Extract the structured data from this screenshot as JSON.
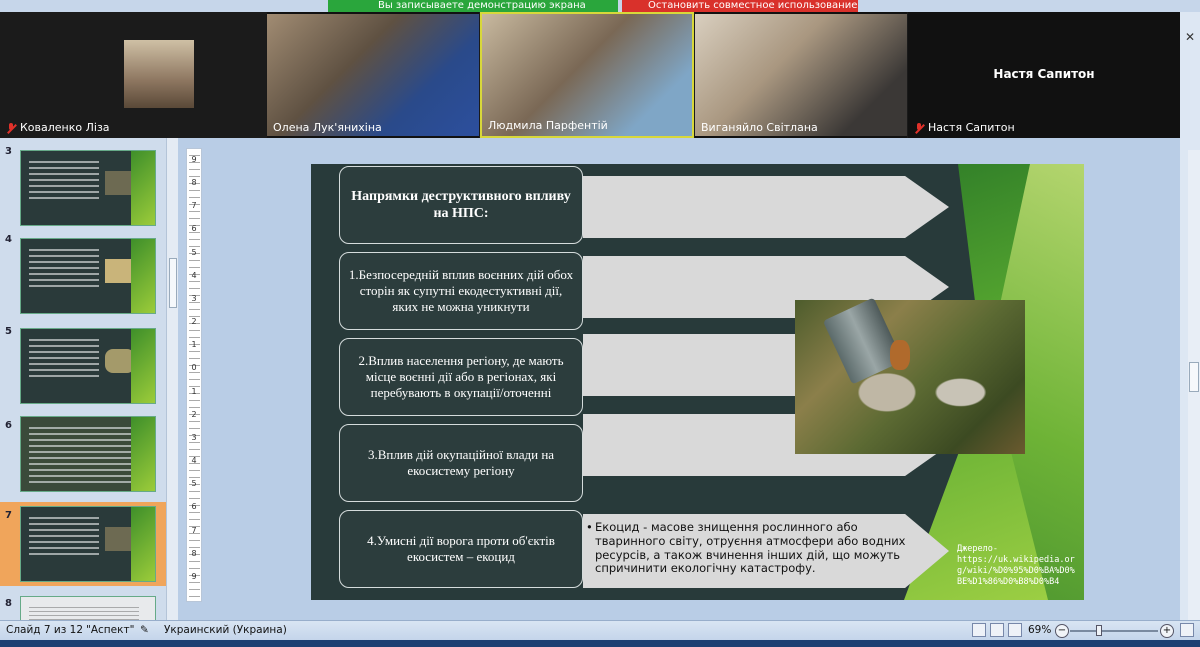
{
  "share_bar": {
    "left_label": "Вы записываете демонстрацию экрана",
    "right_label": "Остановить совместное использование"
  },
  "participants": [
    {
      "name": "Коваленко Ліза",
      "muted": true
    },
    {
      "name": "Олена Лук'янихіна",
      "muted": false
    },
    {
      "name": "Людмила Парфентій",
      "muted": false
    },
    {
      "name": "Виганяйло Світлана",
      "muted": false
    },
    {
      "name": "Настя Сапитон",
      "muted": true,
      "display_title": "Настя Сапитон"
    }
  ],
  "thumbnails": [
    {
      "num": "3"
    },
    {
      "num": "4"
    },
    {
      "num": "5"
    },
    {
      "num": "6"
    },
    {
      "num": "7",
      "active": true
    },
    {
      "num": "8"
    }
  ],
  "ruler_labels": [
    "9",
    "8",
    "7",
    "6",
    "5",
    "4",
    "3",
    "2",
    "1",
    "0",
    "1",
    "2",
    "3",
    "4",
    "5",
    "6",
    "7",
    "8",
    "9"
  ],
  "slide": {
    "title": "Напрямки деструктивного впливу на НПС:",
    "items": [
      "1.Безпосередній вплив воєнних дій обох сторін як супутні екодестуктивні дії, яких не можна уникнути",
      "2.Вплив населення регіону, де мають місце воєнні дії або в регіонах, які перебувають в окупації/оточенні",
      "3.Вплив дій окупаційної влади на екосистему регіону",
      "4.Умисні дії ворога проти об'єктів екосистем – екоцид"
    ],
    "ecocide_text": "Екоцид - масове знищення рослинного або тваринного світу, отруєння атмосфери або водних ресурсів, а також вчинення інших дій, що можуть спричинити екологічну катастрофу.",
    "source_label": "Джерело-",
    "source_url": "https://uk.wikipedia.org/wiki/%D0%95%D0%BA%D0%BE%D1%86%D0%B8%D0%B4"
  },
  "status": {
    "slide": "Слайд 7 из 12",
    "theme": "\"Аспект\"",
    "language": "Украинский (Украина)",
    "zoom": "69%"
  }
}
